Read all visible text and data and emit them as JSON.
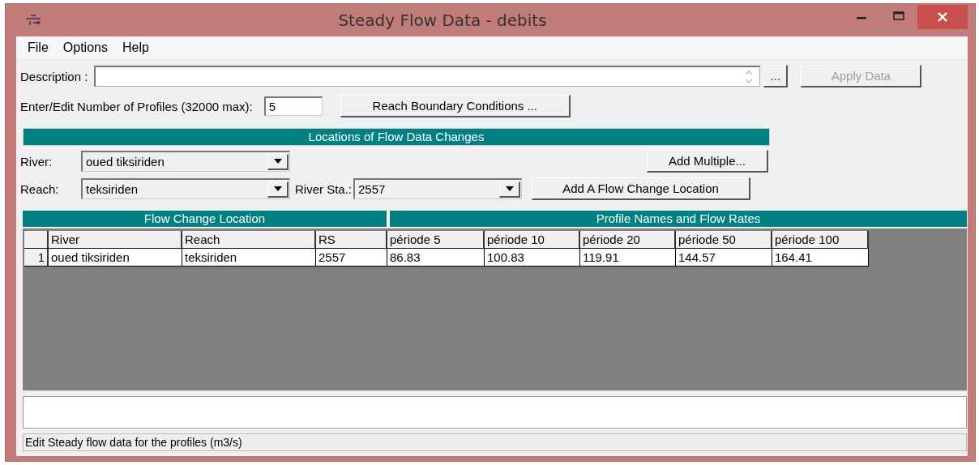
{
  "window": {
    "title": "Steady Flow Data - debits"
  },
  "menu": [
    "File",
    "Options",
    "Help"
  ],
  "description": {
    "label": "Description :"
  },
  "more_button": "...",
  "apply_button": {
    "label": "Apply Data",
    "disabled": true
  },
  "profiles": {
    "label": "Enter/Edit Number of Profiles (32000 max):",
    "value": "5"
  },
  "reach_boundary_button": "Reach Boundary Conditions ...",
  "locations": {
    "title": "Locations of Flow Data Changes",
    "river": {
      "label": "River:",
      "value": "oued tiksiriden"
    },
    "reach": {
      "label": "Reach:",
      "value": "teksiriden"
    },
    "river_sta": {
      "label": "River Sta.:",
      "value": "2557"
    },
    "add_multiple_button": "Add Multiple...",
    "add_location_button": "Add A Flow Change Location"
  },
  "table": {
    "group_headers": [
      "Flow Change Location",
      "Profile Names and Flow Rates"
    ],
    "columns": [
      "River",
      "Reach",
      "RS",
      "période 5",
      "période 10",
      "période 20",
      "période 50",
      "période 100"
    ],
    "rows": [
      {
        "number": "1",
        "cells": [
          "oued tiksiriden",
          "teksiriden",
          "2557",
          "86.83",
          "100.83",
          "119.91",
          "144.57",
          "164.41"
        ]
      }
    ]
  },
  "status_bar": "Edit Steady flow data for the profiles (m3/s)"
}
